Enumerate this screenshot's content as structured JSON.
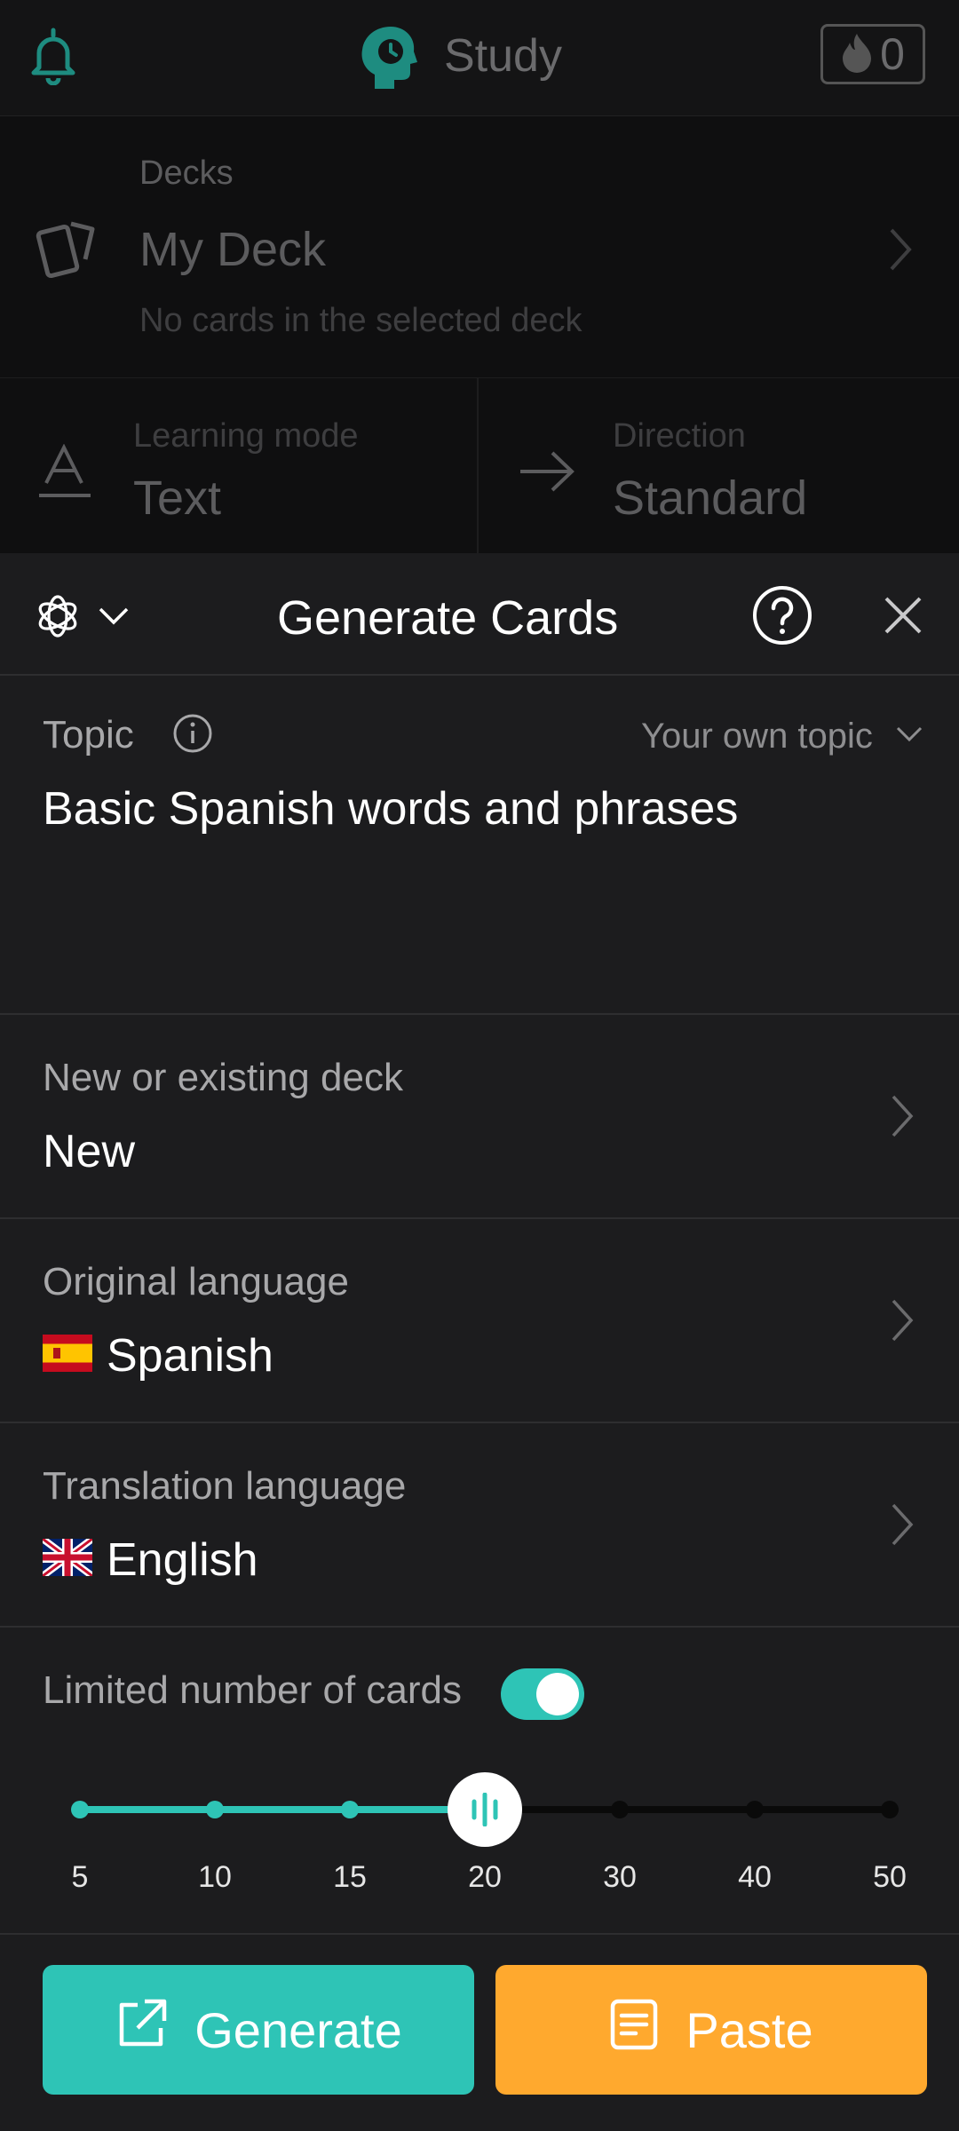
{
  "header": {
    "title": "Study",
    "streak_count": "0"
  },
  "deck": {
    "label": "Decks",
    "name": "My Deck",
    "status": "No cards in the selected deck"
  },
  "learning_mode": {
    "label": "Learning mode",
    "value": "Text"
  },
  "direction": {
    "label": "Direction",
    "value": "Standard"
  },
  "sheet": {
    "title": "Generate Cards",
    "topic": {
      "label": "Topic",
      "selector": "Your own topic",
      "value": "Basic Spanish words and phrases"
    },
    "deck_choice": {
      "label": "New or existing deck",
      "value": "New"
    },
    "original_language": {
      "label": "Original language",
      "value": "Spanish",
      "flag": "spain-flag"
    },
    "translation_language": {
      "label": "Translation language",
      "value": "English",
      "flag": "uk-flag"
    },
    "limit": {
      "label": "Limited number of cards",
      "enabled": true,
      "ticks": [
        "5",
        "10",
        "15",
        "20",
        "30",
        "40",
        "50"
      ],
      "selected": "20"
    },
    "generate_label": "Generate",
    "paste_label": "Paste"
  },
  "colors": {
    "accent": "#2ec4b6",
    "paste": "#ffa92e",
    "sheet_bg": "#1c1c1e"
  }
}
